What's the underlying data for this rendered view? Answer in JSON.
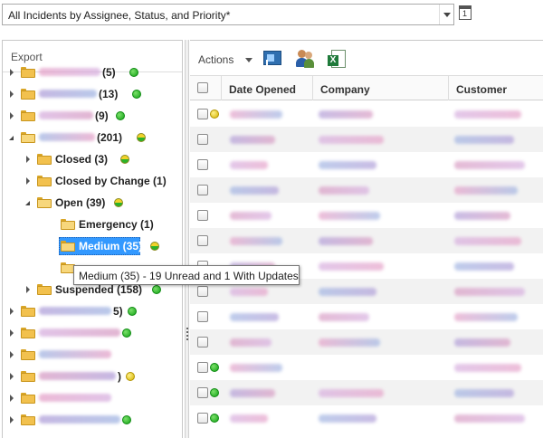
{
  "view_selector": {
    "value": "All Incidents by Assignee, Status, and Priority*",
    "calendar_day": "1"
  },
  "tree": {
    "header": "Export",
    "nodes": [
      {
        "label": "",
        "count": " (5)",
        "dot": "green",
        "state": "collapsed",
        "level": 0,
        "blurred": true
      },
      {
        "label": "",
        "count": " (13)",
        "dot": "green",
        "state": "collapsed",
        "level": 0,
        "blurred": true
      },
      {
        "label": "",
        "count": "(9)",
        "dot": "green",
        "state": "collapsed",
        "level": 0,
        "blurred": true
      },
      {
        "label": "",
        "count": " (201)",
        "dot": "half",
        "state": "expanded",
        "level": 0,
        "blurred": true
      },
      {
        "label": "Closed (3)",
        "count": "",
        "dot": "half",
        "state": "collapsed",
        "level": 1
      },
      {
        "label": "Closed by Change (1)",
        "count": "",
        "dot": "",
        "state": "collapsed",
        "level": 1
      },
      {
        "label": "Open (39)",
        "count": "",
        "dot": "half",
        "state": "expanded",
        "level": 1
      },
      {
        "label": "Emergency (1)",
        "count": "",
        "dot": "",
        "state": "none",
        "level": 2
      },
      {
        "label": "Medium (35)",
        "count": "",
        "dot": "half",
        "state": "none",
        "level": 2,
        "selected": true
      },
      {
        "label": "",
        "count": "",
        "dot": "",
        "state": "none",
        "level": 2
      },
      {
        "label": "Suspended (158)",
        "count": "",
        "dot": "green",
        "state": "collapsed",
        "level": 1
      },
      {
        "label": "",
        "count": "5)",
        "dot": "green",
        "state": "collapsed",
        "level": 0,
        "blurred": true
      },
      {
        "label": "",
        "count": "",
        "dot": "green",
        "state": "collapsed",
        "level": 0,
        "blurred": true
      },
      {
        "label": "",
        "count": "",
        "dot": "",
        "state": "collapsed",
        "level": 0,
        "blurred": true
      },
      {
        "label": "",
        "count": ")",
        "dot": "yellow",
        "state": "collapsed",
        "level": 0,
        "blurred": true
      },
      {
        "label": "",
        "count": "",
        "dot": "",
        "state": "collapsed",
        "level": 0,
        "blurred": true
      },
      {
        "label": "",
        "count": "",
        "dot": "green",
        "state": "collapsed",
        "level": 0,
        "blurred": true
      }
    ],
    "tooltip": "Medium (35) - 19 Unread and 1 With Updates"
  },
  "actions": {
    "label": "Actions"
  },
  "grid": {
    "columns": [
      "Date Opened",
      "Company",
      "Customer"
    ],
    "rows": [
      {
        "dot": "yellow"
      },
      {
        "dot": ""
      },
      {
        "dot": ""
      },
      {
        "dot": ""
      },
      {
        "dot": ""
      },
      {
        "dot": ""
      },
      {
        "dot": ""
      },
      {
        "dot": ""
      },
      {
        "dot": ""
      },
      {
        "dot": ""
      },
      {
        "dot": "green"
      },
      {
        "dot": "green"
      },
      {
        "dot": "green"
      }
    ]
  },
  "colors": {
    "selection": "#3399ff",
    "status_green": "#13a316",
    "status_yellow": "#d5b500",
    "blur_palette": [
      "#e6a3c9",
      "#b2a0d9",
      "#d7b0e0",
      "#a3b7e3",
      "#d99ec4"
    ]
  }
}
